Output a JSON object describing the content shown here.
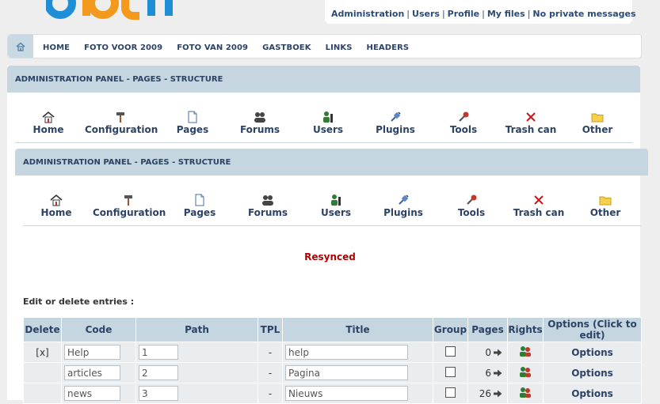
{
  "header": {
    "links": {
      "admin": "Administration",
      "users": "Users",
      "profile": "Profile",
      "myfiles": "My files",
      "messages": "No private messages",
      "sep": "|"
    }
  },
  "nav": [
    "HOME",
    "FOTO VOOR 2009",
    "FOTO VAN 2009",
    "GASTBOEK",
    "LINKS",
    "HEADERS"
  ],
  "panel": {
    "title": "ADMINISTRATION PANEL - PAGES - STRUCTURE",
    "icons": [
      "Home",
      "Configuration",
      "Pages",
      "Forums",
      "Users",
      "Plugins",
      "Tools",
      "Trash can",
      "Other"
    ]
  },
  "status": "Resynced",
  "edit_label": "Edit or delete entries :",
  "table": {
    "headers": [
      "Delete",
      "Code",
      "Path",
      "TPL",
      "Title",
      "Group",
      "Pages",
      "Rights",
      "Options (Click to edit)"
    ],
    "rows": [
      {
        "delete": "[x]",
        "code": "Help",
        "path": "1",
        "tpl": "-",
        "title": "help",
        "pages": "0",
        "options": "Options"
      },
      {
        "delete": "",
        "code": "articles",
        "path": "2",
        "tpl": "-",
        "title": "Pagina",
        "pages": "6",
        "options": "Options"
      },
      {
        "delete": "",
        "code": "news",
        "path": "3",
        "tpl": "-",
        "title": "Nieuws",
        "pages": "26",
        "options": "Options"
      }
    ]
  },
  "colors": {
    "header_blue": "#c5d6e1",
    "text_navy": "#2c4365",
    "status_red": "#b30000"
  }
}
